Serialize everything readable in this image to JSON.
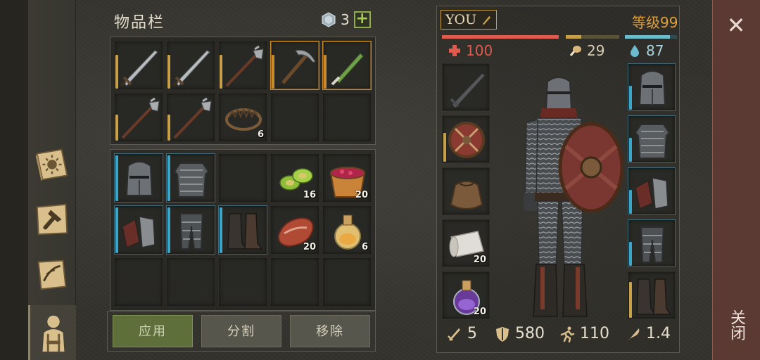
{
  "inventory": {
    "title": "物品栏",
    "gem_count": "3",
    "add_label": "+"
  },
  "crafting_slots": [
    {
      "item": "sword",
      "durability_color": "#c9a04a",
      "durability": 0.7
    },
    {
      "item": "sword",
      "durability_color": "#c9a04a",
      "durability": 0.7
    },
    {
      "item": "halberd",
      "durability_color": "#c9a04a",
      "durability": 0.7
    },
    {
      "item": "pickaxe",
      "durability_color": "#c98a2d",
      "durability": 0.7,
      "selected": true
    },
    {
      "item": "green-dagger",
      "durability_color": "#c98a2d",
      "durability": 0.7,
      "selected": true
    },
    {
      "item": "halberd",
      "durability_color": "#c9a04a",
      "durability": 0.55
    },
    {
      "item": "halberd",
      "durability_color": "#c9a04a",
      "durability": 0.55
    },
    {
      "item": "bear-trap",
      "qty": "6"
    },
    {},
    {}
  ],
  "bag_slots": [
    {
      "item": "great-helm",
      "durability_color": "#3aa6c9",
      "durability": 0.95
    },
    {
      "item": "chain-armor",
      "durability_color": "#3aa6c9",
      "durability": 0.95
    },
    {},
    {
      "item": "green-pods",
      "qty": "16"
    },
    {
      "item": "berry-bowl",
      "qty": "20"
    },
    {
      "item": "gauntlets",
      "durability_color": "#3aa6c9",
      "durability": 0.95
    },
    {
      "item": "chain-legs",
      "durability_color": "#3aa6c9",
      "durability": 0.95
    },
    {
      "item": "boots",
      "durability_color": "#3aa6c9",
      "durability": 0.95
    },
    {
      "item": "raw-meat",
      "qty": "20"
    },
    {
      "item": "potion",
      "qty": "6"
    },
    {},
    {},
    {},
    {},
    {}
  ],
  "buttons": {
    "apply": "应用",
    "split": "分割",
    "remove": "移除"
  },
  "player": {
    "name": "YOU",
    "level": "等级99",
    "health": "100",
    "food": "29",
    "water": "87",
    "health_fraction": 1.0,
    "food_fraction": 0.29,
    "water_fraction": 0.87
  },
  "left_equip": [
    {
      "item": "sword-silhouette"
    },
    {
      "item": "round-shield",
      "durability_color": "#c9a04a",
      "durability": 0.6
    },
    {
      "item": "pouch"
    },
    {
      "item": "scroll",
      "qty": "20"
    },
    {
      "item": "potion-purple",
      "qty": "20"
    }
  ],
  "right_equip": [
    {
      "item": "great-helm",
      "durability_color": "#3aa6c9",
      "durability": 0.5
    },
    {
      "item": "chain-armor",
      "durability_color": "#3aa6c9",
      "durability": 0.5
    },
    {
      "item": "gauntlets",
      "durability_color": "#3aa6c9",
      "durability": 0.5
    },
    {
      "item": "chain-legs",
      "durability_color": "#3aa6c9",
      "durability": 0.5
    },
    {
      "item": "boots",
      "durability_color": "#c9a04a",
      "durability": 0.75
    }
  ],
  "bottom_stats": {
    "attack": "5",
    "armor": "580",
    "speed": "110",
    "weight": "1.4"
  },
  "close": {
    "icon": "close-icon",
    "label": "关闭"
  },
  "colors": {
    "health": "#e05a4e",
    "food": "#c9a04a",
    "water": "#6bbccd",
    "accent": "#e0a03c"
  }
}
